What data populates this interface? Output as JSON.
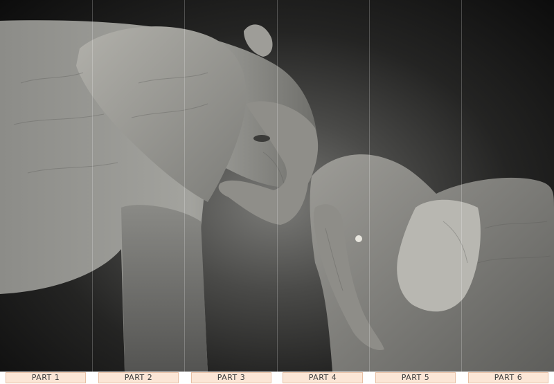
{
  "panels": [
    {
      "label": "PART 1"
    },
    {
      "label": "PART 2"
    },
    {
      "label": "PART 3"
    },
    {
      "label": "PART 4"
    },
    {
      "label": "PART 5"
    },
    {
      "label": "PART 6"
    }
  ]
}
